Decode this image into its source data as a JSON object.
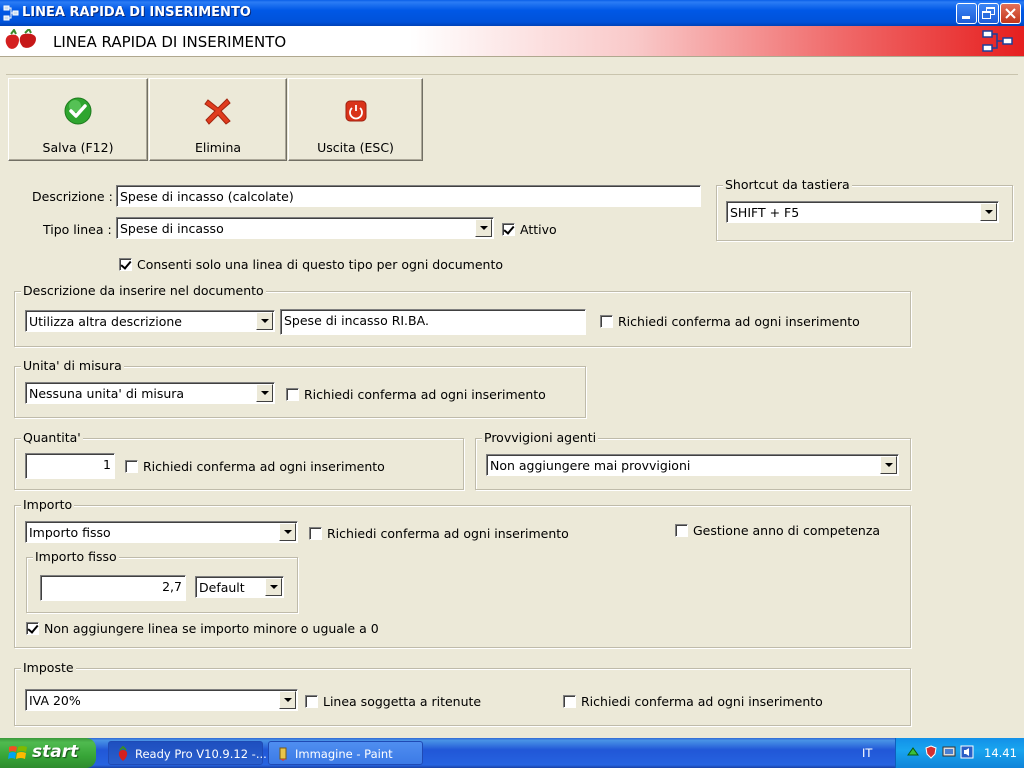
{
  "window": {
    "title": "LINEA RAPIDA DI INSERIMENTO",
    "header_title": "LINEA RAPIDA DI INSERIMENTO"
  },
  "toolbar": {
    "save_label": "Salva (F12)",
    "delete_label": "Elimina",
    "exit_label": "Uscita (ESC)"
  },
  "form": {
    "descrizione_label": "Descrizione :",
    "descrizione_value": "Spese di incasso (calcolate)",
    "tipo_linea_label": "Tipo linea :",
    "tipo_linea_value": "Spese di incasso",
    "attivo_label": "Attivo",
    "attivo_checked": true,
    "consenti_label": "Consenti solo una linea di questo tipo per ogni documento",
    "consenti_checked": true
  },
  "shortcut": {
    "title": "Shortcut da tastiera",
    "value": "SHIFT + F5"
  },
  "descr_doc": {
    "title": "Descrizione da inserire nel documento",
    "mode_value": "Utilizza altra descrizione",
    "text_value": "Spese di incasso RI.BA.",
    "confirm_label": "Richiedi conferma ad ogni inserimento",
    "confirm_checked": false
  },
  "unita": {
    "title": "Unita' di misura",
    "value": "Nessuna unita' di misura",
    "confirm_label": "Richiedi conferma ad ogni inserimento",
    "confirm_checked": false
  },
  "quantita": {
    "title": "Quantita'",
    "value": "1",
    "confirm_label": "Richiedi conferma ad ogni inserimento",
    "confirm_checked": false
  },
  "provvigioni": {
    "title": "Provvigioni agenti",
    "value": "Non aggiungere mai provvigioni"
  },
  "importo": {
    "title": "Importo",
    "mode_value": "Importo fisso",
    "confirm_label": "Richiedi conferma ad ogni inserimento",
    "confirm_checked": false,
    "gestione_label": "Gestione anno di competenza",
    "gestione_checked": false,
    "fisso_title": "Importo fisso",
    "fisso_value": "2,7",
    "fisso_currency": "Default",
    "non_aggiungere_label": "Non aggiungere linea se importo minore o uguale a 0",
    "non_aggiungere_checked": true
  },
  "imposte": {
    "title": "Imposte",
    "value": "IVA 20%",
    "ritenute_label": "Linea soggetta a ritenute",
    "ritenute_checked": false,
    "confirm_label": "Richiedi conferma ad ogni inserimento",
    "confirm_checked": false
  },
  "taskbar": {
    "start_label": "start",
    "task1_label": "Ready Pro V10.9.12 -...",
    "task2_label": "Immagine - Paint",
    "lang": "IT",
    "clock": "14.41"
  },
  "colors": {
    "titlebar_blue": "#0058E6",
    "header_red": "#E61F1F",
    "dialog_bg": "#ECE9D8",
    "save_green": "#2FA52F",
    "delete_red": "#E03C1E",
    "exit_red": "#D9331A"
  }
}
